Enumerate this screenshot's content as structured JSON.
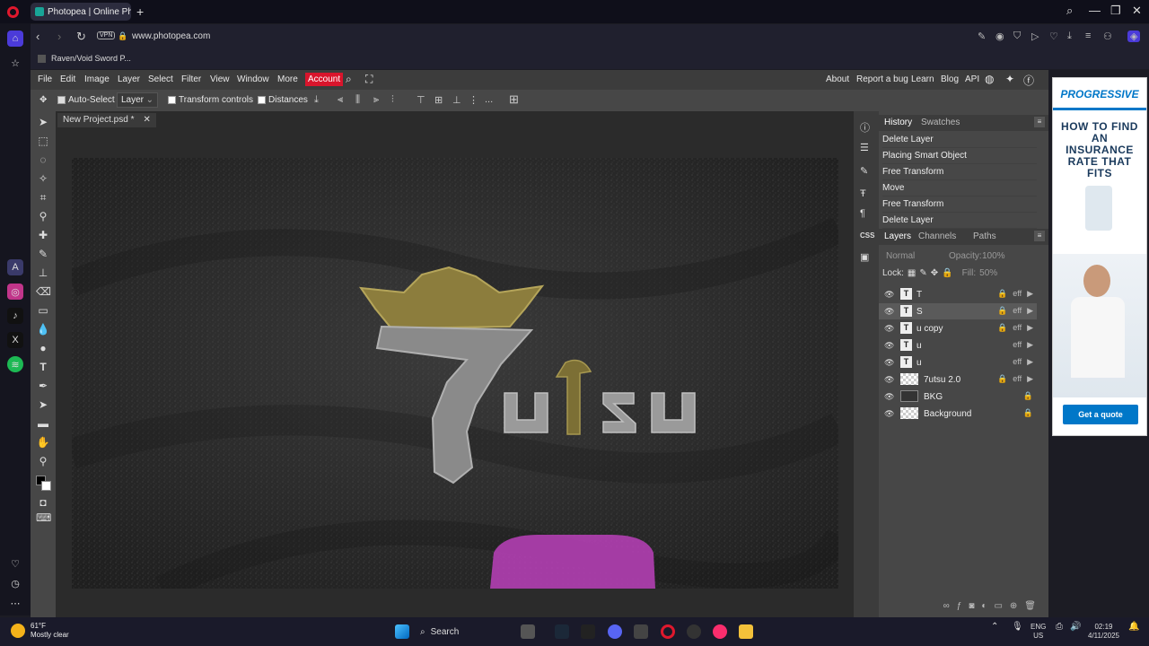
{
  "browser": {
    "tab_title": "Photopea | Online Photo E",
    "tab_close": "✕",
    "new_tab": "+",
    "vpn": "VPN",
    "url": "www.photopea.com",
    "bookmark": "Raven/Void Sword P...",
    "window_minimize": "—",
    "window_maximize": "❐",
    "window_close": "✕"
  },
  "menu": {
    "items": [
      "File",
      "Edit",
      "Image",
      "Layer",
      "Select",
      "Filter",
      "View",
      "Window",
      "More"
    ],
    "account": "Account",
    "right_items": [
      "About",
      "Report a bug",
      "Learn",
      "Blog",
      "API"
    ]
  },
  "options": {
    "auto_select": "Auto-Select",
    "layer_dropdown": "Layer",
    "transform_controls": "Transform controls",
    "distances": "Distances",
    "more": "..."
  },
  "document": {
    "tab_name": "New Project.psd *",
    "close": "✕"
  },
  "artwork": {
    "logo_number": "7",
    "logo_word": "utsu"
  },
  "history_panel": {
    "tabs": [
      "History",
      "Swatches"
    ],
    "items": [
      "Delete Layer",
      "Placing Smart Object",
      "Free Transform",
      "Move",
      "Free Transform",
      "Delete Layer"
    ]
  },
  "layers_panel": {
    "tabs": [
      "Layers",
      "Channels",
      "Paths"
    ],
    "blend_mode": "Normal",
    "opacity_label": "Opacity:",
    "opacity_value": "100%",
    "lock_label": "Lock:",
    "fill_label": "Fill:",
    "fill_value": "50%",
    "layers": [
      {
        "name": "T",
        "type": "text",
        "selected": false
      },
      {
        "name": "S",
        "type": "text",
        "selected": true
      },
      {
        "name": "u copy",
        "type": "text",
        "selected": false
      },
      {
        "name": "u",
        "type": "text",
        "selected": false
      },
      {
        "name": "u",
        "type": "text",
        "selected": false
      },
      {
        "name": "7utsu 2.0",
        "type": "image",
        "selected": false
      },
      {
        "name": "BKG",
        "type": "image",
        "selected": false
      },
      {
        "name": "Background",
        "type": "image",
        "selected": false
      }
    ],
    "fx_label": "eff"
  },
  "ad": {
    "brand": "PROGRESSIVE",
    "headline": "HOW TO FIND AN INSURANCE RATE THAT FITS",
    "cta": "Get a quote"
  },
  "taskbar": {
    "temperature": "61°F",
    "condition": "Mostly clear",
    "search": "Search",
    "language": "ENG",
    "region": "US",
    "time": "02:19",
    "date": "4/11/2025"
  },
  "colors": {
    "accent_red": "#d9152c",
    "panel": "#474747",
    "canvas_bg": "#2b2b2b"
  }
}
